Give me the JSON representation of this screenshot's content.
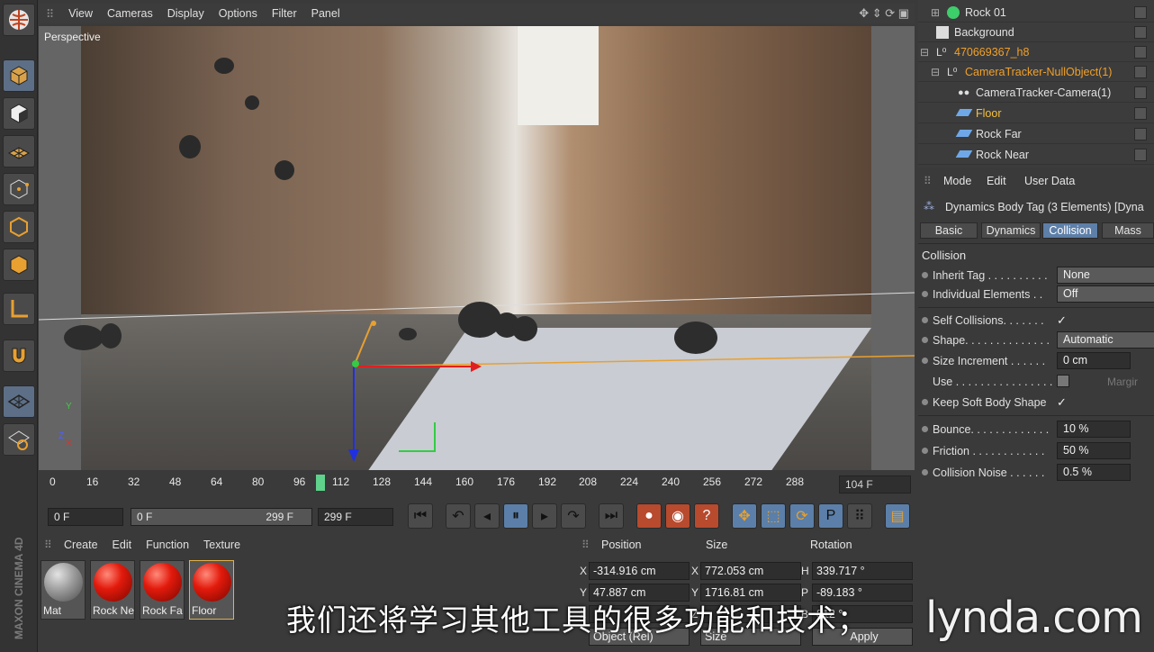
{
  "viewport": {
    "menu": [
      "View",
      "Cameras",
      "Display",
      "Options",
      "Filter",
      "Panel"
    ],
    "label": "Perspective"
  },
  "timeline": {
    "ticks": [
      "0",
      "16",
      "32",
      "48",
      "64",
      "80",
      "96",
      "112",
      "128",
      "144",
      "160",
      "176",
      "192",
      "208",
      "224",
      "240",
      "256",
      "272",
      "288"
    ],
    "current_frame": "104 F"
  },
  "transport": {
    "start": "0 F",
    "range_start": "0 F",
    "range_end": "299 F",
    "end": "299 F"
  },
  "materials": {
    "menu": [
      "Create",
      "Edit",
      "Function",
      "Texture"
    ],
    "items": [
      "Mat",
      "Rock Ne",
      "Rock Fa",
      "Floor"
    ]
  },
  "coordinates": {
    "headers": [
      "Position",
      "Size",
      "Rotation"
    ],
    "axes_pos": [
      "X",
      "Y",
      "Z"
    ],
    "axes_size": [
      "X",
      "Y",
      "Z"
    ],
    "axes_rot": [
      "H",
      "P",
      "B"
    ],
    "position": [
      "-314.916 cm",
      "47.887 cm",
      ""
    ],
    "size": [
      "772.053 cm",
      "1716.81 cm",
      ""
    ],
    "rotation": [
      "339.717 °",
      "-89.183 °",
      "812 °"
    ],
    "mode1": "Object (Rel)",
    "mode2": "Size",
    "apply": "Apply"
  },
  "objects": [
    {
      "name": "Rock 01"
    },
    {
      "name": "Background"
    },
    {
      "name": "470669367_h8"
    },
    {
      "name": "CameraTracker-NullObject(1)"
    },
    {
      "name": "CameraTracker-Camera(1)"
    },
    {
      "name": "Floor"
    },
    {
      "name": "Rock Far"
    },
    {
      "name": "Rock Near"
    }
  ],
  "attributes": {
    "menu": [
      "Mode",
      "Edit",
      "User Data"
    ],
    "title": "Dynamics Body Tag (3 Elements) [Dyna",
    "tabs": [
      "Basic",
      "Dynamics",
      "Collision",
      "Mass"
    ],
    "section": "Collision",
    "props": {
      "inherit_tag": {
        "label": "Inherit Tag . . . . . . . . . .",
        "value": "None"
      },
      "individual": {
        "label": "Individual Elements . .",
        "value": "Off"
      },
      "self_collisions": {
        "label": "Self Collisions. . . . . . .",
        "value": "✓"
      },
      "shape": {
        "label": "Shape. . . . . . . . . . . . . .",
        "value": "Automatic"
      },
      "size_increment": {
        "label": "Size Increment . . . . . .",
        "value": "0 cm"
      },
      "use": {
        "label": "Use . . . . . . . . . . . . . . . .",
        "margin": "Margir"
      },
      "keep_soft": {
        "label": "Keep Soft Body Shape",
        "value": "✓"
      },
      "bounce": {
        "label": "Bounce. . . . . . . . . . . . .",
        "value": "10 %"
      },
      "friction": {
        "label": "Friction . . . . . . . . . . . .",
        "value": "50 %"
      },
      "collision_noise": {
        "label": "Collision Noise . . . . . .",
        "value": "0.5 %"
      }
    }
  },
  "subtitle": "我们还将学习其他工具的很多功能和技术；",
  "watermark": "lynda.com",
  "brand": "MAXON CINEMA 4D"
}
